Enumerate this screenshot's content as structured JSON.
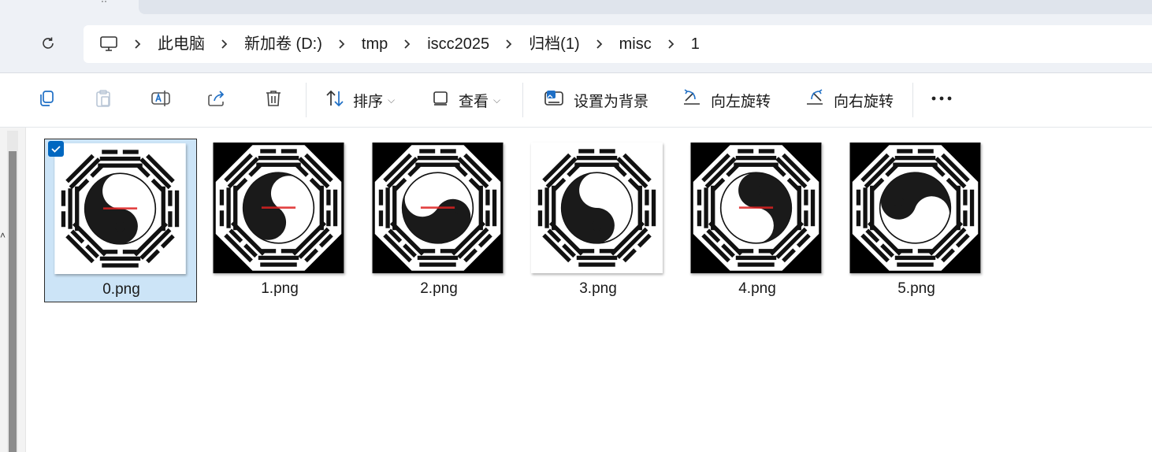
{
  "window": {
    "tab_glyph": "··"
  },
  "address": {
    "refresh_icon": "refresh-icon",
    "root_icon": "computer-icon",
    "crumbs": [
      "此电脑",
      "新加卷 (D:)",
      "tmp",
      "iscc2025",
      "归档(1)",
      "misc",
      "1"
    ]
  },
  "toolbar": {
    "copy_icon": "copy-icon",
    "paste_icon": "paste-icon",
    "rename_icon": "rename-icon",
    "share_icon": "share-icon",
    "delete_icon": "delete-icon",
    "sort_label": "排序",
    "view_label": "查看",
    "set_background_label": "设置为背景",
    "rotate_left_label": "向左旋转",
    "rotate_right_label": "向右旋转",
    "more_icon": "more-icon"
  },
  "files": [
    {
      "name": "0.png",
      "selected": true,
      "background": "white",
      "swirl": "normal",
      "red_text": true
    },
    {
      "name": "1.png",
      "selected": false,
      "background": "black",
      "swirl": "rotated",
      "red_text": true
    },
    {
      "name": "2.png",
      "selected": false,
      "background": "black",
      "swirl": "rotated2",
      "red_text": true
    },
    {
      "name": "3.png",
      "selected": false,
      "background": "white",
      "swirl": "normal",
      "red_text": false
    },
    {
      "name": "4.png",
      "selected": false,
      "background": "black",
      "swirl": "mirrored",
      "red_text": true
    },
    {
      "name": "5.png",
      "selected": false,
      "background": "black",
      "swirl": "rotated3",
      "red_text": false
    }
  ],
  "colors": {
    "accent": "#0067c0",
    "selection": "#cce4f7",
    "chrome": "#eef1f6"
  }
}
